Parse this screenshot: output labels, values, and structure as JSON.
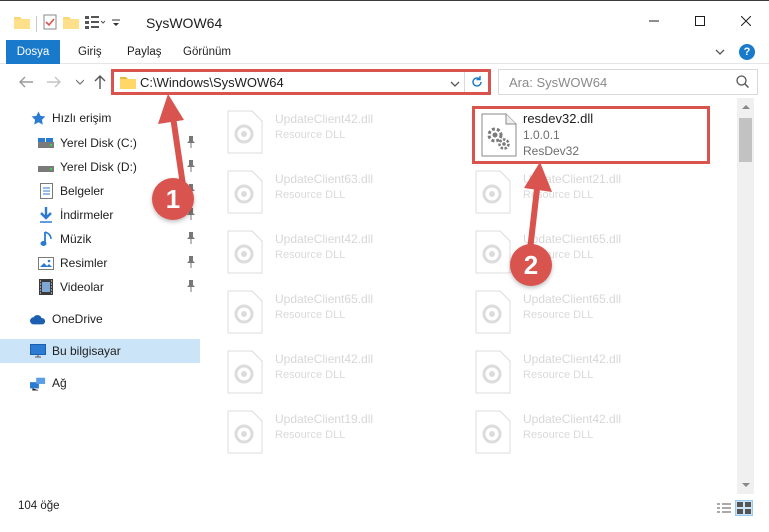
{
  "window": {
    "title": "SysWOW64"
  },
  "ribbon": {
    "tabs": [
      "Dosya",
      "Giriş",
      "Paylaş",
      "Görünüm"
    ]
  },
  "address_bar": {
    "path": "C:\\Windows\\SysWOW64"
  },
  "search": {
    "placeholder": "Ara: SysWOW64"
  },
  "sidebar": {
    "quick_access": "Hızlı erişim",
    "items": [
      {
        "label": "Yerel Disk (C:)",
        "icon": "drive-icon"
      },
      {
        "label": "Yerel Disk (D:)",
        "icon": "drive-icon"
      },
      {
        "label": "Belgeler",
        "icon": "documents-icon"
      },
      {
        "label": "İndirmeler",
        "icon": "downloads-icon"
      },
      {
        "label": "Müzik",
        "icon": "music-icon"
      },
      {
        "label": "Resimler",
        "icon": "pictures-icon"
      },
      {
        "label": "Videolar",
        "icon": "videos-icon"
      }
    ],
    "onedrive": "OneDrive",
    "this_pc": "Bu bilgisayar",
    "network": "Ağ"
  },
  "files": {
    "left_column": [
      {
        "name": "UpdateClient42.dll",
        "desc": "Resource DLL"
      },
      {
        "name": "UpdateClient63.dll",
        "desc": "Resource DLL"
      },
      {
        "name": "UpdateClient42.dll",
        "desc": "Resource DLL"
      },
      {
        "name": "UpdateClient65.dll",
        "desc": "Resource DLL"
      },
      {
        "name": "UpdateClient42.dll",
        "desc": "Resource DLL"
      },
      {
        "name": "UpdateClient19.dll",
        "desc": "Resource DLL"
      }
    ],
    "right_column": [
      {
        "name": "UpdateClient21.dll",
        "desc": "Resource DLL"
      },
      {
        "name": "UpdateClient65.dll",
        "desc": "Resource DLL"
      },
      {
        "name": "UpdateClient65.dll",
        "desc": "Resource DLL"
      },
      {
        "name": "UpdateClient42.dll",
        "desc": "Resource DLL"
      },
      {
        "name": "UpdateClient42.dll",
        "desc": "Resource DLL"
      }
    ],
    "highlighted": {
      "name": "resdev32.dll",
      "version": "1.0.0.1",
      "desc": "ResDev32"
    }
  },
  "status": {
    "count": "104 öğe"
  },
  "annotations": {
    "step1": "1",
    "step2": "2"
  },
  "colors": {
    "accent": "#1979ca",
    "annotation_red": "#d9534f",
    "selection": "#cce4f7"
  }
}
